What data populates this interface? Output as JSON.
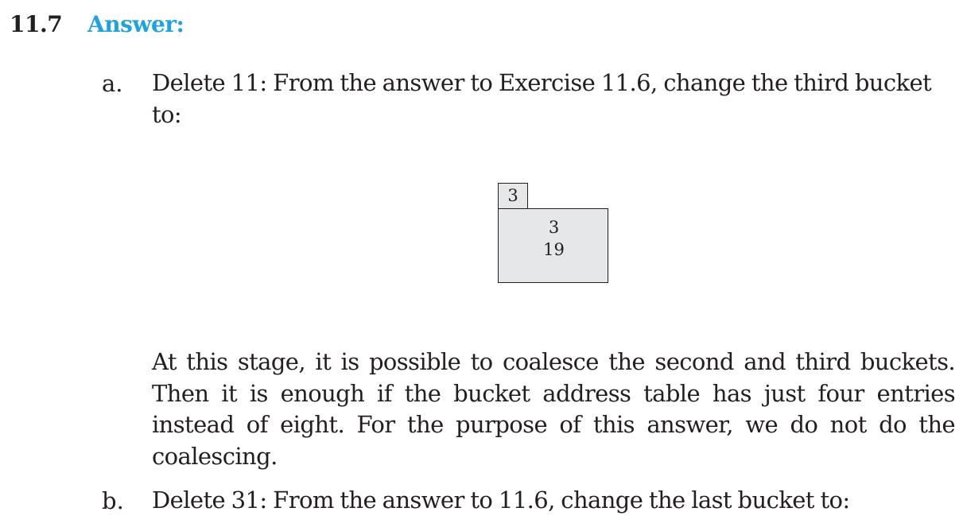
{
  "section": {
    "number": "11.7",
    "title": "Answer:"
  },
  "items": [
    {
      "marker": "a.",
      "text": "Delete 11: From the answer to Exercise 11.6, change the third bucket to:"
    },
    {
      "marker": "b.",
      "text": "Delete 31: From the answer to 11.6, change the last bucket to:"
    }
  ],
  "figure": {
    "local_depth": "3",
    "entries": [
      "3",
      "19"
    ]
  },
  "note": "At this stage, it is possible to coalesce the second and third buckets. Then it is enough if the bucket address table has just four entries instead of eight. For the purpose of this answer, we do not do the coalescing."
}
